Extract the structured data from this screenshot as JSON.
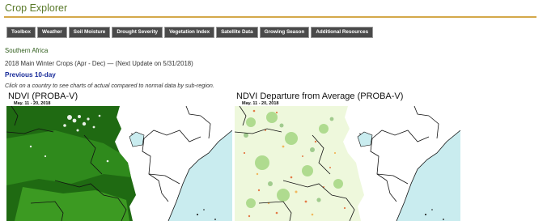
{
  "header": {
    "title": "Crop Explorer"
  },
  "nav": {
    "items": [
      {
        "label": "Toolbox"
      },
      {
        "label": "Weather"
      },
      {
        "label": "Soil Moisture"
      },
      {
        "label": "Drought Severity"
      },
      {
        "label": "Vegetation Index"
      },
      {
        "label": "Satellite Data"
      },
      {
        "label": "Growing Season"
      },
      {
        "label": "Additional Resources"
      }
    ]
  },
  "content": {
    "region": "Southern Africa",
    "update_line": "2018 Main Winter Crops (Apr - Dec) — (Next Update on 5/31/2018)",
    "period_link": "Previous 10-day",
    "instructions": "Click on a country to see charts of actual compared to normal data by sub-region."
  },
  "maps": [
    {
      "title": "NDVI (PROBA-V)",
      "date": "May. 11 - 20, 2018"
    },
    {
      "title": "NDVI Departure from Average (PROBA-V)",
      "date": "May. 11 - 20, 2018"
    }
  ],
  "colors": {
    "title": "#5a7a2a",
    "accent_rule": "#d4a84a",
    "nav_bg": "#4a4a4a",
    "link": "#1a2d9a",
    "ocean": "#c9ecef",
    "land_background": "#ffffff",
    "ndvi_dense": "#1f6a12",
    "departure_base": "#eef8dc"
  }
}
